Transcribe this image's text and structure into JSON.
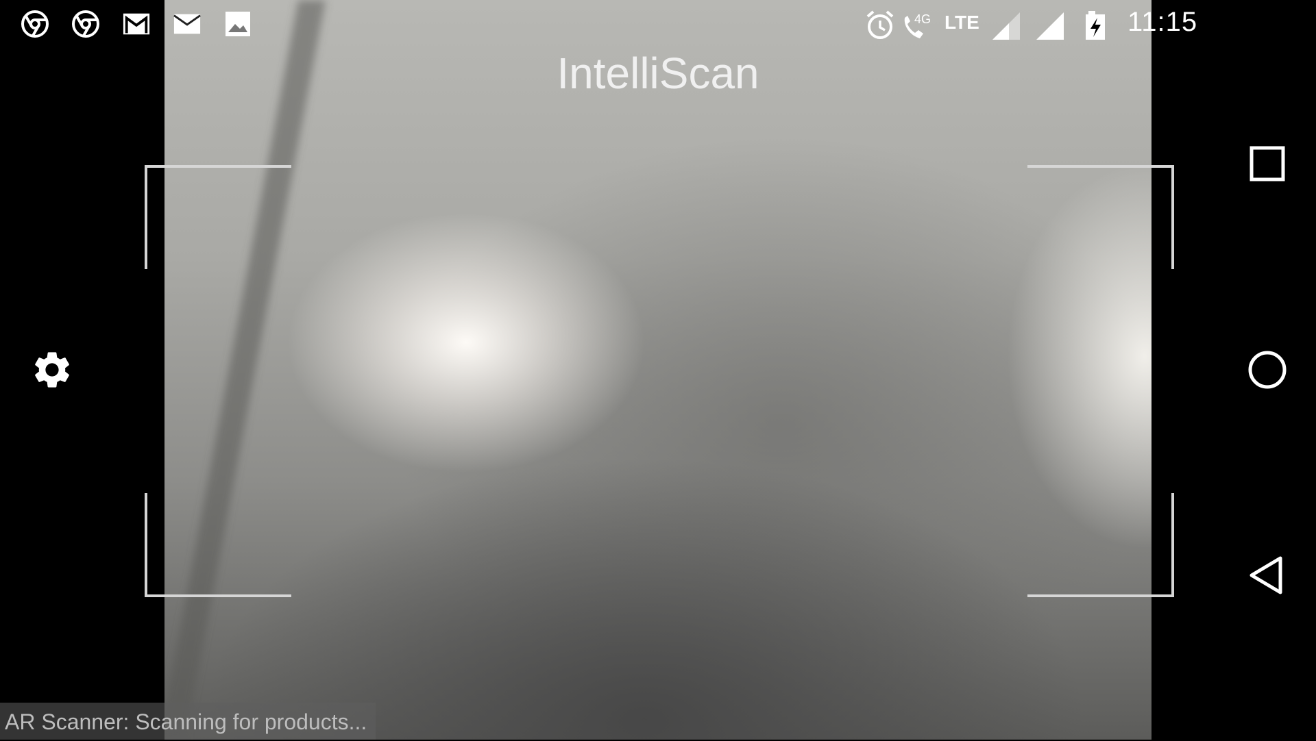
{
  "status_bar": {
    "notification_icons": [
      "chrome-icon",
      "chrome-icon",
      "gmail-icon",
      "email-icon",
      "image-icon"
    ],
    "network_label": "4G",
    "lte_label": "LTE",
    "time": "11:15"
  },
  "app": {
    "title": "IntelliScan",
    "scan_status": "AR Scanner: Scanning for products..."
  },
  "nav_bar": {
    "buttons": [
      "recent-apps-button",
      "home-button",
      "back-button"
    ]
  },
  "colors": {
    "frame": "#d6d6d6",
    "background": "#000000",
    "text": "#f0f0f0"
  }
}
